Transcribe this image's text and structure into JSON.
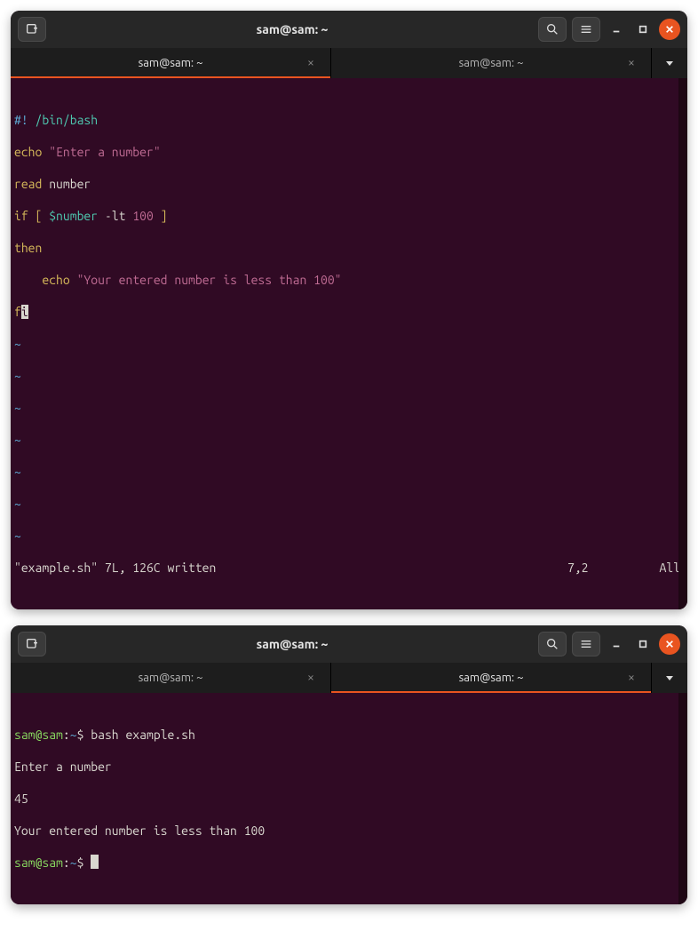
{
  "window1": {
    "title": "sam@sam: ~",
    "tabs": [
      {
        "label": "sam@sam: ~",
        "active": true
      },
      {
        "label": "sam@sam: ~",
        "active": false
      }
    ],
    "editor": {
      "shebang_marker": "#!",
      "shebang_path": " /bin/bash",
      "line2_cmd": "echo",
      "line2_str": "\"Enter a number\"",
      "line3_cmd": "read",
      "line3_arg": " number",
      "line4_if": "if",
      "line4_open": " [ ",
      "line4_var": "$number",
      "line4_op": " -lt ",
      "line4_num": "100",
      "line4_close": " ]",
      "line5_then": "then",
      "line6_indent": "    ",
      "line6_cmd": "echo",
      "line6_str": "\"Your entered number is less than 100\"",
      "line7_fi_first": "f",
      "line7_fi_second": "i",
      "tilde": "~"
    },
    "status": {
      "message": "\"example.sh\" 7L, 126C written",
      "position": "7,2",
      "scroll": "All"
    }
  },
  "window2": {
    "title": "sam@sam: ~",
    "tabs": [
      {
        "label": "sam@sam: ~",
        "active": false
      },
      {
        "label": "sam@sam: ~",
        "active": true
      }
    ],
    "session": {
      "prompt_user": "sam@sam",
      "prompt_sep": ":",
      "prompt_path": "~",
      "prompt_dollar": "$",
      "cmd1": " bash example.sh",
      "out1": "Enter a number",
      "input1": "45",
      "out2": "Your entered number is less than 100"
    }
  }
}
